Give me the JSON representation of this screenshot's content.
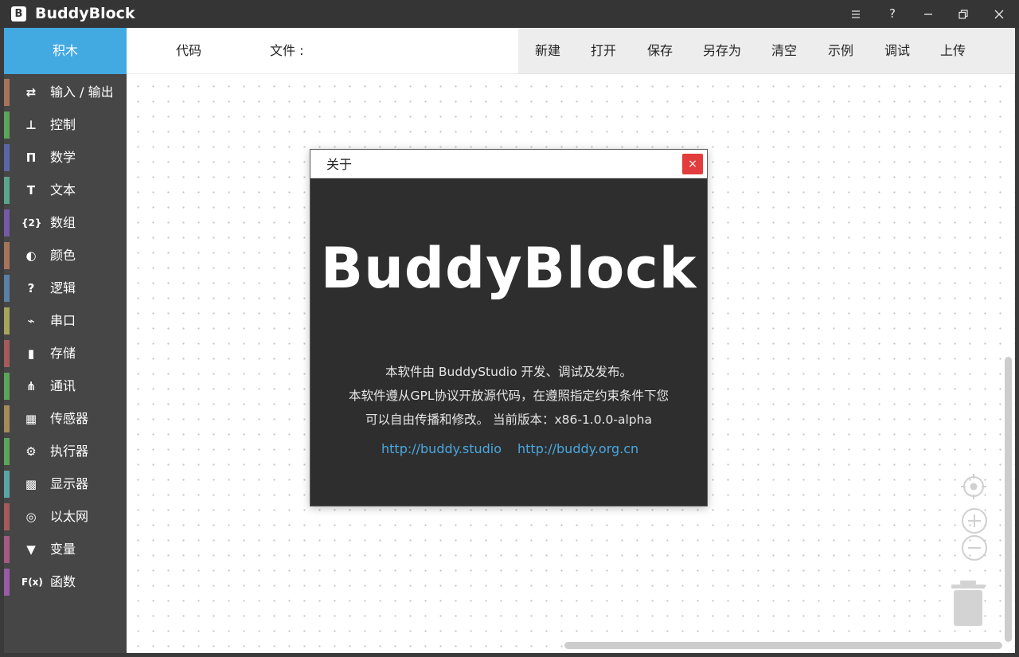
{
  "window": {
    "logo_text": "B",
    "title": "BuddyBlock",
    "menu_glyph": "☰",
    "help_glyph": "?",
    "minimize_glyph": "—",
    "close_glyph": "✕"
  },
  "tabs": {
    "blocks": "积木",
    "code": "代码",
    "file_label": "文件 :"
  },
  "toolbar": {
    "new": "新建",
    "open": "打开",
    "save": "保存",
    "save_as": "另存为",
    "clear": "清空",
    "examples": "示例",
    "debug": "调试",
    "upload": "上传"
  },
  "categories": [
    {
      "label": "输入 / 输出",
      "icon": "swap-arrows-icon",
      "glyph": "⇄",
      "color": "#a5745b"
    },
    {
      "label": "控制",
      "icon": "stamp-icon",
      "glyph": "⊥",
      "color": "#5ba55b"
    },
    {
      "label": "数学",
      "icon": "pi-icon",
      "glyph": "Π",
      "color": "#5b67a5"
    },
    {
      "label": "文本",
      "icon": "text-t-icon",
      "glyph": "T",
      "color": "#5ba58c"
    },
    {
      "label": "数组",
      "icon": "braces-icon",
      "glyph": "{2}",
      "color": "#745ba5"
    },
    {
      "label": "颜色",
      "icon": "palette-icon",
      "glyph": "◐",
      "color": "#a5745b"
    },
    {
      "label": "逻辑",
      "icon": "question-icon",
      "glyph": "?",
      "color": "#5b80a5"
    },
    {
      "label": "串口",
      "icon": "plug-icon",
      "glyph": "⌁",
      "color": "#a5a55b"
    },
    {
      "label": "存储",
      "icon": "file-icon",
      "glyph": "▮",
      "color": "#a55b5b"
    },
    {
      "label": "通讯",
      "icon": "network-icon",
      "glyph": "⋔",
      "color": "#5ba55b"
    },
    {
      "label": "传感器",
      "icon": "chip-icon",
      "glyph": "▦",
      "color": "#a58a5b"
    },
    {
      "label": "执行器",
      "icon": "motor-icon",
      "glyph": "⚙",
      "color": "#5ba55b"
    },
    {
      "label": "显示器",
      "icon": "grid-display-icon",
      "glyph": "▩",
      "color": "#5ba5a5"
    },
    {
      "label": "以太网",
      "icon": "globe-icon",
      "glyph": "◎",
      "color": "#a55b5b"
    },
    {
      "label": "变量",
      "icon": "bookmark-icon",
      "glyph": "▼",
      "color": "#a55b80"
    },
    {
      "label": "函数",
      "icon": "function-icon",
      "glyph": "F(x)",
      "color": "#995ba5"
    }
  ],
  "about_dialog": {
    "title": "关于",
    "close_glyph": "×",
    "brand": "BuddyBlock",
    "line1": "本软件由 BuddyStudio 开发、调试及发布。",
    "line2": "本软件遵从GPL协议开放源代码，在遵照指定约束条件下您",
    "line3": "可以自由传播和修改。  当前版本：x86-1.0.0-alpha",
    "link1": "http://buddy.studio",
    "link2": "http://buddy.org.cn"
  },
  "colors": {
    "accent_blue": "#43a9e1",
    "sidebar_bg": "#464646",
    "titlebar_bg": "#353535",
    "dialog_bg": "#2e2e2e",
    "close_red": "#e23c3c",
    "link_blue": "#4aa8e0"
  }
}
